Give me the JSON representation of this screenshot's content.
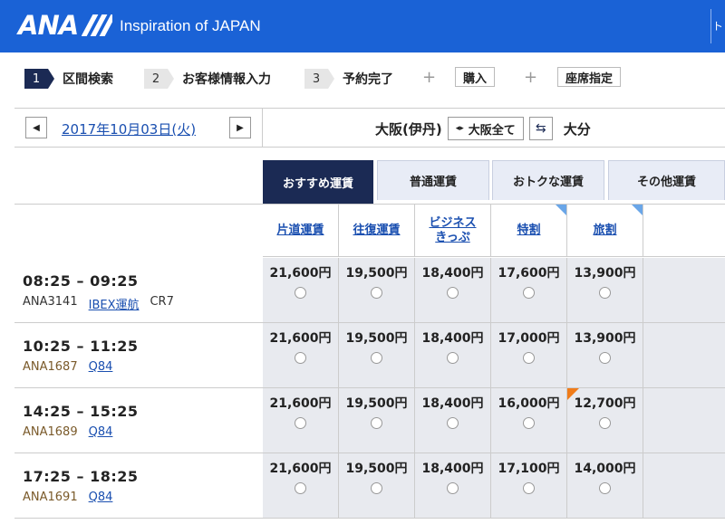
{
  "header": {
    "logo": "ANA",
    "tagline": "Inspiration of JAPAN",
    "right_text": "ト"
  },
  "steps": [
    {
      "num": "1",
      "label": "区間検索"
    },
    {
      "num": "2",
      "label": "お客様情報入力"
    },
    {
      "num": "3",
      "label": "予約完了"
    }
  ],
  "extra": {
    "plus": "+",
    "purchase": "購入",
    "seat": "座席指定"
  },
  "date_bar": {
    "prev": "◀",
    "next": "▶",
    "date": "2017年10月03日(火)",
    "from": "大阪(伊丹)",
    "dir_icon": "◂▸",
    "select": "大阪全て",
    "swap": "⇆",
    "to": "大分"
  },
  "tabs": [
    "おすすめ運賃",
    "普通運賃",
    "おトクな運賃",
    "その他運賃"
  ],
  "fare_types": [
    "片道運賃",
    "往復運賃",
    "ビジネス\nきっぷ",
    "特割",
    "旅割"
  ],
  "flights": [
    {
      "time": "08:25 – 09:25",
      "number": "ANA3141",
      "aircraft_link": "IBEX運航",
      "aircraft": "CR7",
      "prices": [
        "21,600円",
        "19,500円",
        "18,400円",
        "17,600円",
        "13,900円"
      ]
    },
    {
      "time": "10:25 – 11:25",
      "number": "ANA1687",
      "aircraft_link": "Q84",
      "aircraft": "",
      "prices": [
        "21,600円",
        "19,500円",
        "18,400円",
        "17,000円",
        "13,900円"
      ]
    },
    {
      "time": "14:25 – 15:25",
      "number": "ANA1689",
      "aircraft_link": "Q84",
      "aircraft": "",
      "prices": [
        "21,600円",
        "19,500円",
        "18,400円",
        "16,000円",
        "12,700円"
      ]
    },
    {
      "time": "17:25 – 18:25",
      "number": "ANA1691",
      "aircraft_link": "Q84",
      "aircraft": "",
      "prices": [
        "21,600円",
        "19,500円",
        "18,400円",
        "17,100円",
        "14,000円"
      ]
    }
  ],
  "colors": {
    "brand": "#1a62d6",
    "navy": "#1b2a54",
    "link": "#1a4fb0",
    "flag": "#f07c1a"
  }
}
